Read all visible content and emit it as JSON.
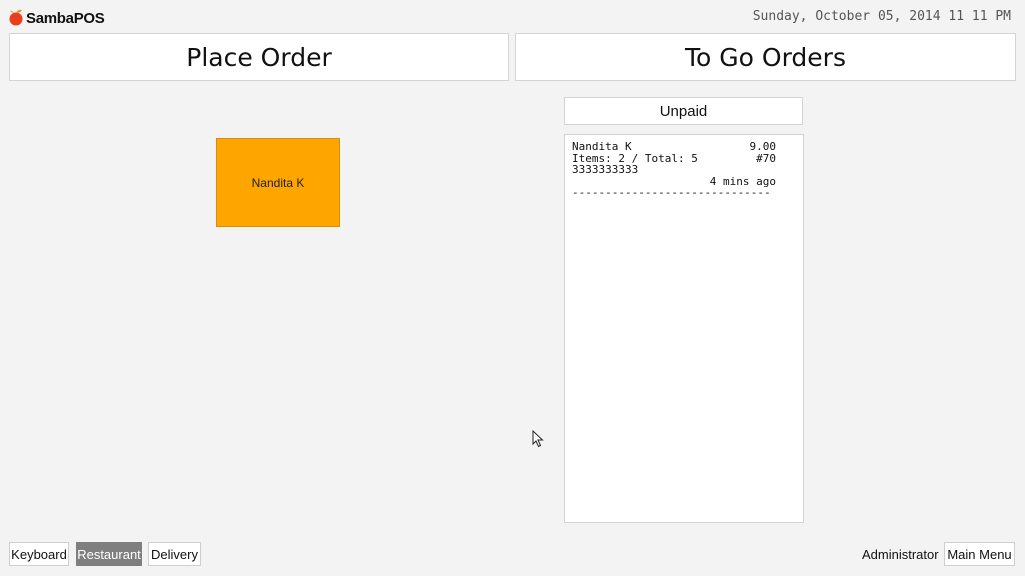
{
  "app": {
    "logo_text": "SambaPOS"
  },
  "header": {
    "datetime": "Sunday, October 05, 2014 11 11 PM"
  },
  "buttons": {
    "place_order": "Place Order",
    "to_go_orders": "To Go Orders"
  },
  "entities": [
    {
      "name": "Nandita K",
      "color": "#ffa500"
    }
  ],
  "ticket_filter": {
    "label": "Unpaid"
  },
  "tickets": [
    {
      "customer": "Nandita K",
      "amount": "9.00",
      "items_total": "Items: 2 / Total: 5",
      "ticket_number": "#70",
      "phone": "3333333333",
      "age": "4 mins ago",
      "separator": "------------------------------"
    }
  ],
  "footer": {
    "keyboard": "Keyboard",
    "restaurant": "Restaurant",
    "delivery": "Delivery",
    "user": "Administrator",
    "main_menu": "Main Menu"
  },
  "colors": {
    "accent": "#ffa500",
    "selected": "#7f7f7f",
    "logo": "#e8401c"
  }
}
